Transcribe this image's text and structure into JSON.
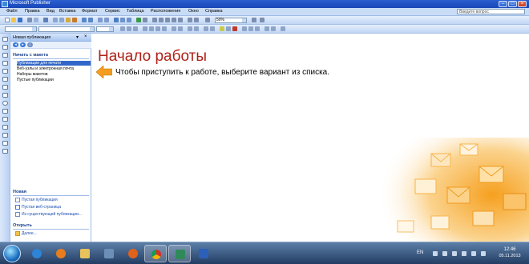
{
  "window": {
    "title": "Microsoft Publisher"
  },
  "menu": {
    "items": [
      "Файл",
      "Правка",
      "Вид",
      "Вставка",
      "Формат",
      "Сервис",
      "Таблица",
      "Расположение",
      "Окно",
      "Справка"
    ],
    "help_placeholder": "Введите вопрос"
  },
  "toolbar": {
    "zoom": "50%"
  },
  "task_pane": {
    "title": "Новая публикация",
    "start_section": "Начать с макета",
    "tree": [
      "Публикации для печати",
      "Веб-узлы и электронная почта",
      "Наборы макетов",
      "Пустые публикации"
    ],
    "new_section": "Новая",
    "new_links": [
      "Пустая публикация",
      "Пустая веб-страница",
      "Из существующей публикации..."
    ],
    "open_section": "Открыть",
    "open_links": [
      "Далее..."
    ]
  },
  "main": {
    "heading": "Начало работы",
    "subtitle": "Чтобы приступить к работе, выберите вариант из списка."
  },
  "taskbar": {
    "language": "EN",
    "time": "12:46",
    "date": "05.11.2013"
  },
  "colors": {
    "heading": "#b0221a",
    "accent_orange": "#f39c1f",
    "selection": "#3167c8"
  }
}
